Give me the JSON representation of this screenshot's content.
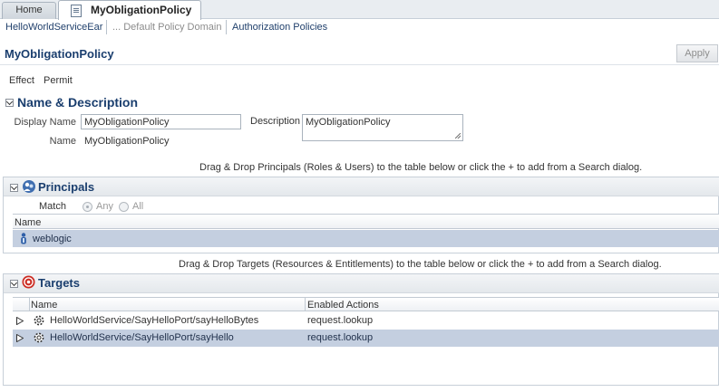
{
  "tabs": [
    {
      "label": "Home"
    },
    {
      "label": "MyObligationPolicy"
    }
  ],
  "breadcrumb": [
    {
      "label": "HelloWorldServiceEar"
    },
    {
      "label": "... Default Policy Domain"
    },
    {
      "label": "Authorization Policies"
    }
  ],
  "page": {
    "title": "MyObligationPolicy",
    "apply_label": "Apply"
  },
  "effect": {
    "label": "Effect",
    "value": "Permit"
  },
  "name_desc": {
    "title": "Name & Description",
    "display_name_label": "Display Name",
    "display_name_value": "MyObligationPolicy",
    "description_label": "Description",
    "description_value": "MyObligationPolicy",
    "name_label": "Name",
    "name_value": "MyObligationPolicy"
  },
  "principals": {
    "hint": "Drag & Drop Principals (Roles & Users) to the table below or click the + to add from a Search dialog.",
    "title": "Principals",
    "match_label": "Match",
    "options": [
      "Any",
      "All"
    ],
    "selected": "Any",
    "column": "Name",
    "rows": [
      {
        "name": "weblogic"
      }
    ]
  },
  "targets": {
    "hint": "Drag & Drop Targets (Resources & Entitlements) to the table below or click the + to add from a Search dialog.",
    "title": "Targets",
    "columns": [
      "Name",
      "Enabled Actions"
    ],
    "rows": [
      {
        "name": "HelloWorldService/SayHelloPort/sayHelloBytes",
        "actions": "request.lookup"
      },
      {
        "name": "HelloWorldService/SayHelloPort/sayHello",
        "actions": "request.lookup"
      }
    ]
  },
  "colors": {
    "title_blue": "#1a3e6e",
    "selected_row": "#c4cfe0",
    "link": "#1f3f6b"
  }
}
